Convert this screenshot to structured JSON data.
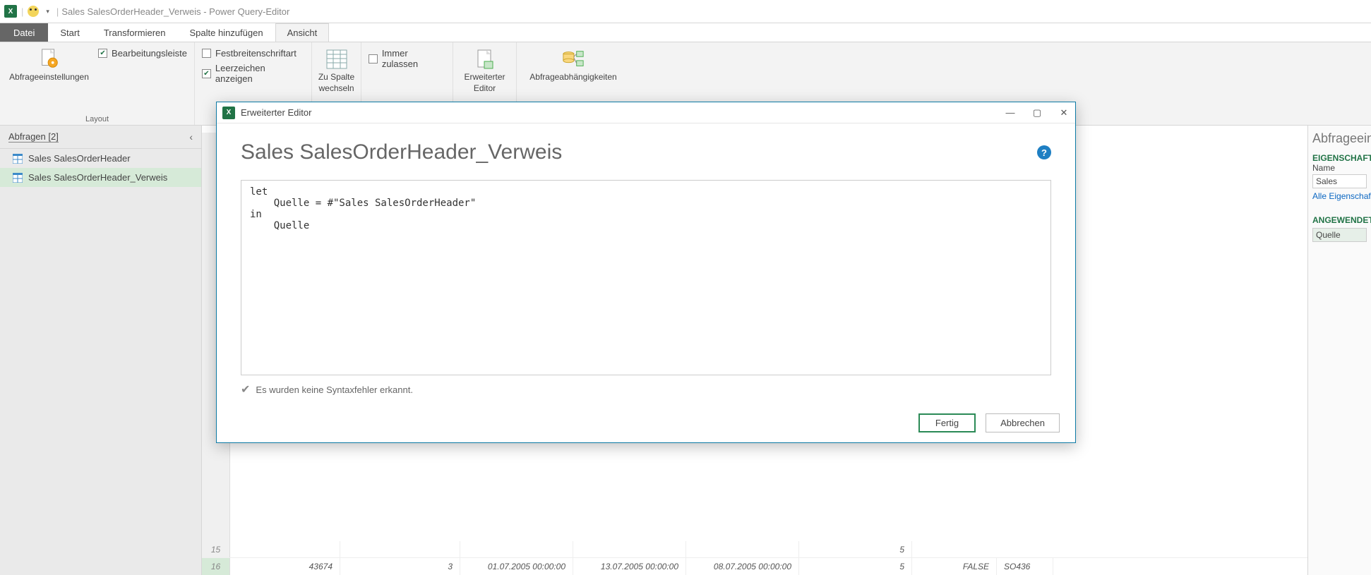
{
  "titlebar": {
    "app_short": "X",
    "document": "Sales SalesOrderHeader_Verweis",
    "app_name": "Power Query-Editor"
  },
  "tabs": {
    "datei": "Datei",
    "start": "Start",
    "transformieren": "Transformieren",
    "spalte": "Spalte hinzufügen",
    "ansicht": "Ansicht"
  },
  "ribbon": {
    "layout_group": "Layout",
    "abfrageeinstellungen": "Abfrageeinstellungen",
    "bearbeitungsleiste": "Bearbeitungsleiste",
    "festbreitenschriftart": "Festbreitenschriftart",
    "leerzeichen": "Leerzeichen anzeigen",
    "zu_spalte_line1": "Zu Spalte",
    "zu_spalte_line2": "wechseln",
    "immer_zulassen": "Immer zulassen",
    "erweiterter_line1": "Erweiterter",
    "erweiterter_line2": "Editor",
    "abfrageabh": "Abfrageabhängigkeiten"
  },
  "queries_pane": {
    "header": "Abfragen [2]",
    "items": [
      "Sales SalesOrderHeader",
      "Sales SalesOrderHeader_Verweis"
    ]
  },
  "settings_pane": {
    "header": "Abfrageeinstellungen",
    "eigen": "EIGENSCHAFTEN",
    "name_label": "Name",
    "name_value": "Sales",
    "alle_eig": "Alle Eigenschaften",
    "angew": "ANGEWENDETE SCHRITTE",
    "step": "Quelle"
  },
  "grid": {
    "row15": {
      "num": "15",
      "c5": "5"
    },
    "row16": {
      "num": "16",
      "c1": "43674",
      "c2": "3",
      "c3": "01.07.2005 00:00:00",
      "c4": "13.07.2005 00:00:00",
      "c5": "08.07.2005 00:00:00",
      "c6": "5",
      "c7": "FALSE",
      "c8": "SO436"
    }
  },
  "modal": {
    "title": "Erweiterter Editor",
    "heading": "Sales SalesOrderHeader_Verweis",
    "code": "let\n    Quelle = #\"Sales SalesOrderHeader\"\nin\n    Quelle",
    "syntax_ok": "Es wurden keine Syntaxfehler erkannt.",
    "done": "Fertig",
    "cancel": "Abbrechen",
    "help": "?"
  }
}
